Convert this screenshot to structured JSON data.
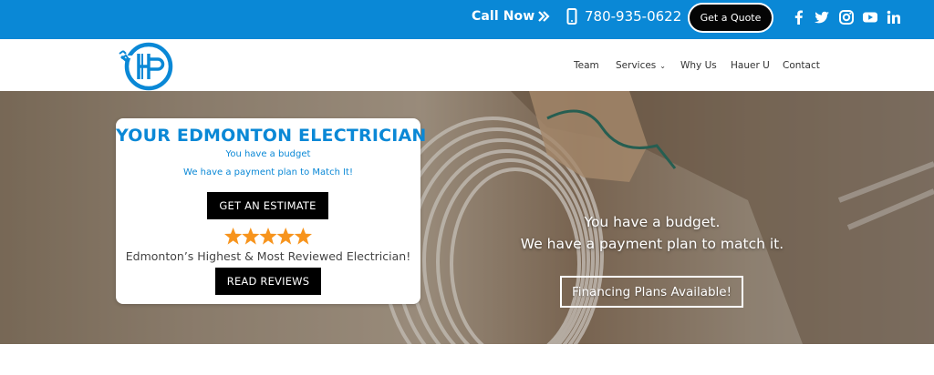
{
  "topbar": {
    "call_now": "Call Now",
    "phone": "780-935-0622",
    "quote_label": "Get a Quote",
    "social": [
      "facebook",
      "twitter",
      "instagram",
      "youtube",
      "linkedin"
    ],
    "bg_color": "#0a88d6"
  },
  "nav": {
    "items": [
      {
        "label": "Team"
      },
      {
        "label": "Services"
      },
      {
        "label": "Why Us"
      },
      {
        "label": "Hauer U"
      },
      {
        "label": "Contact"
      }
    ]
  },
  "card": {
    "title": "YOUR EDMONTON ELECTRICIAN",
    "sub1": "You have a budget",
    "sub2": "We have a payment plan to Match It!",
    "estimate_label": "GET AN ESTIMATE",
    "rating_stars": 5,
    "tagline": "Edmonton’s Highest & Most Reviewed Electrician!",
    "reviews_label": "READ REVIEWS"
  },
  "hero": {
    "line1": "You have a budget.",
    "line2": "We have a payment plan to match it.",
    "finance_label": "Financing Plans Available!"
  },
  "colors": {
    "accent": "#0a88d6",
    "star": "#f7941d"
  }
}
